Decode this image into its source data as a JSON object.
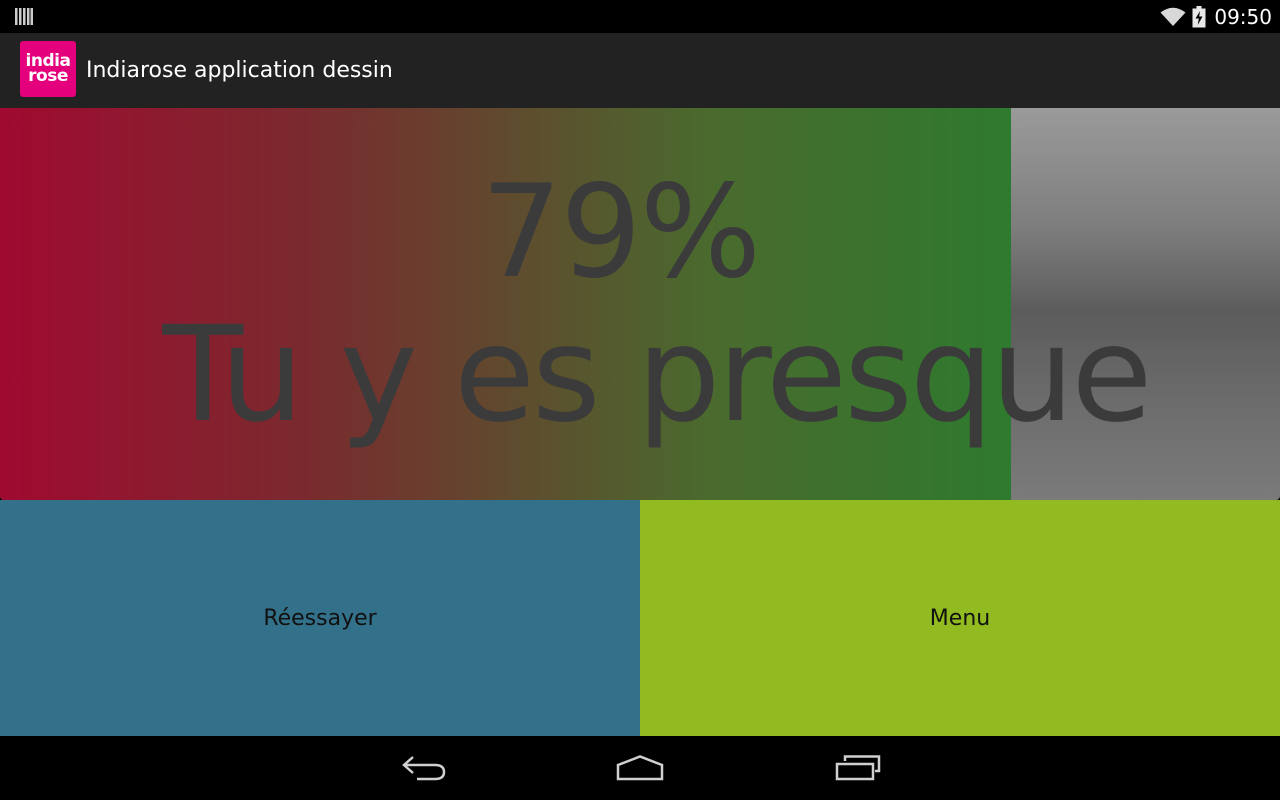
{
  "status_bar": {
    "time": "09:50",
    "icons": [
      "notification-bars-icon",
      "wifi-icon",
      "battery-charging-icon"
    ]
  },
  "action_bar": {
    "logo_line1": "india",
    "logo_line2": "rose",
    "title": "Indiarose application dessin"
  },
  "result": {
    "percent_label": "79%",
    "progress_fraction": 0.79,
    "message": "Tu y es presque"
  },
  "buttons": {
    "retry_label": "Réessayer",
    "menu_label": "Menu"
  },
  "nav_bar": {
    "icons": [
      "back-icon",
      "home-icon",
      "recent-apps-icon"
    ]
  },
  "colors": {
    "logo": "#e4007c",
    "retry_button": "#33718a",
    "menu_button": "#91bb20",
    "progress_start": "#a00a30",
    "progress_end": "#2e7a2e"
  }
}
